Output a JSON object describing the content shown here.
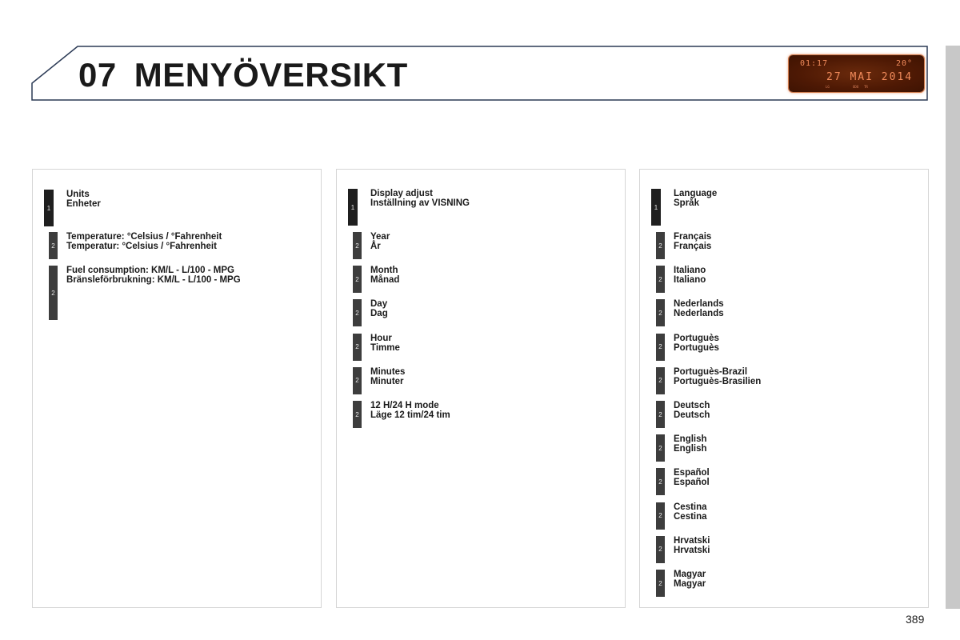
{
  "header": {
    "chapter_number": "07",
    "chapter_title": "MENYÖVERSIKT",
    "frame_color": "#2b3a55"
  },
  "lcd_display": {
    "time": "01:17",
    "temperature": "20°",
    "date": "27 MAI 2014",
    "small_labels": [
      "LG",
      "ODO",
      "TR"
    ],
    "text_color": "#f08a5a",
    "background_color": "#4e1904"
  },
  "panels": [
    {
      "entries": [
        {
          "level": "1",
          "line1": "Units",
          "line2": "Enheter"
        },
        {
          "level": "2",
          "line1": "Temperature: °Celsius / °Fahrenheit",
          "line2": "Temperatur: °Celsius / °Fahrenheit"
        },
        {
          "level": "2",
          "line1": "Fuel consumption: KM/L - L/100 - MPG",
          "line2": "Bränsleförbrukning: KM/L - L/100 - MPG"
        }
      ]
    },
    {
      "entries": [
        {
          "level": "1",
          "line1": "Display adjust",
          "line2": "Inställning av VISNING"
        },
        {
          "level": "2",
          "line1": "Year",
          "line2": "År"
        },
        {
          "level": "2",
          "line1": "Month",
          "line2": "Månad"
        },
        {
          "level": "2",
          "line1": "Day",
          "line2": "Dag"
        },
        {
          "level": "2",
          "line1": "Hour",
          "line2": "Timme"
        },
        {
          "level": "2",
          "line1": "Minutes",
          "line2": "Minuter"
        },
        {
          "level": "2",
          "line1": "12 H/24 H mode",
          "line2": "Läge 12 tim/24 tim"
        }
      ]
    },
    {
      "entries": [
        {
          "level": "1",
          "line1": "Language",
          "line2": "Språk"
        },
        {
          "level": "2",
          "line1": "Français",
          "line2": "Français"
        },
        {
          "level": "2",
          "line1": "Italiano",
          "line2": "Italiano"
        },
        {
          "level": "2",
          "line1": "Nederlands",
          "line2": "Nederlands"
        },
        {
          "level": "2",
          "line1": "Portuguès",
          "line2": "Portuguès"
        },
        {
          "level": "2",
          "line1": "Portuguès-Brazil",
          "line2": "Portuguès-Brasilien"
        },
        {
          "level": "2",
          "line1": "Deutsch",
          "line2": "Deutsch"
        },
        {
          "level": "2",
          "line1": "English",
          "line2": "English"
        },
        {
          "level": "2",
          "line1": "Español",
          "line2": "Español"
        },
        {
          "level": "2",
          "line1": "Cestina",
          "line2": "Cestina"
        },
        {
          "level": "2",
          "line1": "Hrvatski",
          "line2": "Hrvatski"
        },
        {
          "level": "2",
          "line1": "Magyar",
          "line2": "Magyar"
        }
      ]
    }
  ],
  "page_number": "389"
}
